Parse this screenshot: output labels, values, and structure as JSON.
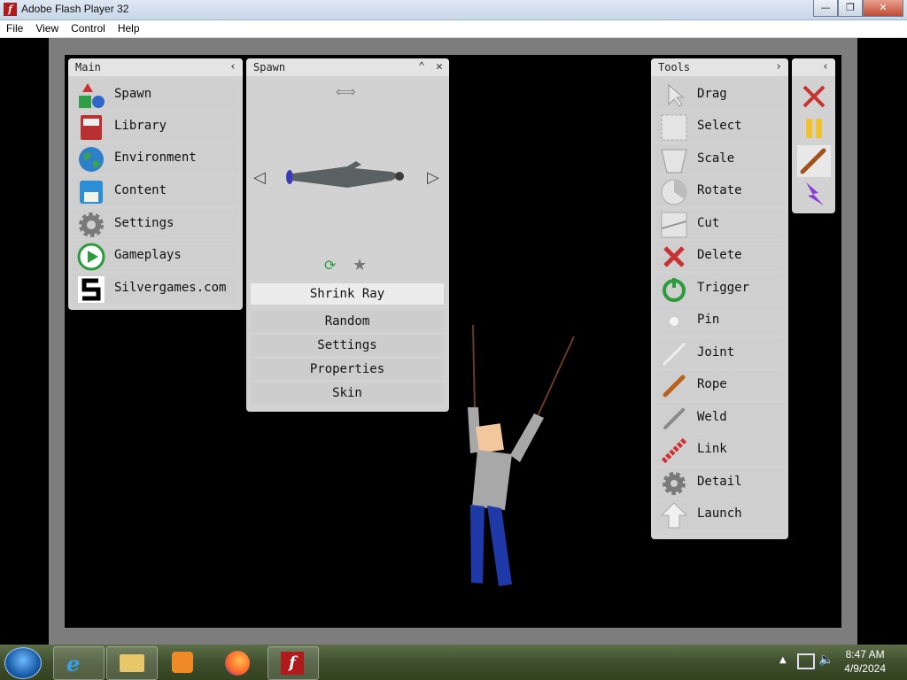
{
  "window": {
    "title": "Adobe Flash Player 32",
    "controls": [
      "—",
      "❐",
      "✕"
    ]
  },
  "menubar": [
    "File",
    "View",
    "Control",
    "Help"
  ],
  "main_panel": {
    "title": "Main",
    "items": [
      {
        "label": "Spawn"
      },
      {
        "label": "Library"
      },
      {
        "label": "Environment"
      },
      {
        "label": "Content"
      },
      {
        "label": "Settings"
      },
      {
        "label": "Gameplays"
      },
      {
        "label": "Silvergames.com"
      }
    ]
  },
  "spawn_panel": {
    "title": "Spawn",
    "selected_item": "Shrink Ray",
    "buttons": [
      "Random",
      "Settings",
      "Properties",
      "Skin"
    ]
  },
  "tools_panel": {
    "title": "Tools",
    "items": [
      {
        "label": "Drag"
      },
      {
        "label": "Select"
      },
      {
        "label": "Scale"
      },
      {
        "label": "Rotate"
      },
      {
        "label": "Cut"
      },
      {
        "label": "Delete"
      },
      {
        "label": "Trigger"
      },
      {
        "label": "Pin"
      },
      {
        "label": "Joint"
      },
      {
        "label": "Rope"
      },
      {
        "label": "Weld"
      },
      {
        "label": "Link"
      },
      {
        "label": "Detail"
      },
      {
        "label": "Launch"
      }
    ]
  },
  "side_toolbar": {
    "icons": [
      "close-x-icon",
      "pause-icon",
      "rope-icon",
      "lightning-icon"
    ]
  },
  "taskbar": {
    "time": "8:47 AM",
    "date": "4/9/2024"
  },
  "colors": {
    "panel_bg": "#d2d2d2",
    "panel_header": "#e4e4e4",
    "stage_bg": "#000000",
    "frame": "#7d7d7d"
  }
}
